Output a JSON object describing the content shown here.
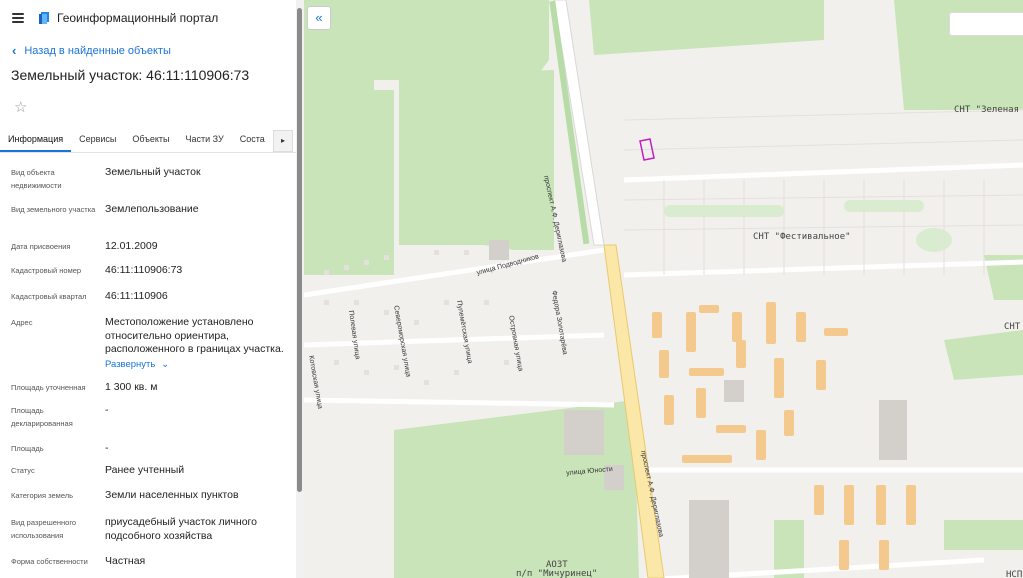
{
  "header": {
    "app_title": "Геоинформационный портал"
  },
  "nav": {
    "back_label": "Назад в найденные объекты"
  },
  "object": {
    "title": "Земельный участок: 46:11:110906:73"
  },
  "tabs": [
    "Информация",
    "Сервисы",
    "Объекты",
    "Части ЗУ",
    "Соста"
  ],
  "fields": [
    {
      "label": "Вид объекта недвижимости",
      "value": "Земельный участок"
    },
    {
      "label": "Вид земельного участка",
      "value": "Землепользование"
    },
    {
      "label": "Дата присвоения",
      "value": "12.01.2009"
    },
    {
      "label": "Кадастровый номер",
      "value": "46:11:110906:73"
    },
    {
      "label": "Кадастровый квартал",
      "value": "46:11:110906"
    },
    {
      "label": "Адрес",
      "value": "Местоположение установлено относительно ориентира, расположенного в границах участка."
    },
    {
      "label": "Площадь уточненная",
      "value": "1 300 кв. м"
    },
    {
      "label": "Площадь декларированная",
      "value": "-"
    },
    {
      "label": "Площадь",
      "value": "-"
    },
    {
      "label": "Статус",
      "value": "Ранее учтенный"
    },
    {
      "label": "Категория земель",
      "value": "Земли населенных пунктов"
    },
    {
      "label": "Вид разрешенного использования",
      "value": "приусадебный участок личного подсобного хозяйства"
    },
    {
      "label": "Форма собственности",
      "value": "Частная"
    }
  ],
  "expand_label": "Развернуть",
  "map": {
    "labels": {
      "snt_zelenaya": "СНТ \"Зеленая Роща\"",
      "snt_festivalnoe": "СНТ \"Фестивальное\"",
      "snt_right": "СНТ",
      "snt_br": "НСП",
      "azs": "АОЗТ",
      "stop": "п/п \"Мичуринец\""
    },
    "streets": {
      "prospekt_top": "проспект А.Ф. Дериглазова",
      "prospekt_bottom": "проспект А.Ф. Дериглазова",
      "podvodnikov": "улица Подводников",
      "yunosti": "улица Юности",
      "polevaya": "Полевая улица",
      "severomorskaya": "Североморская улица",
      "pulemetnaya": "Пулемётская улица",
      "ostrovnaya": "Островная улица",
      "zolotarev": "Федора Золотарёва",
      "kotovskaya": "Котовская улица"
    }
  },
  "colors": {
    "accent": "#1a73d9",
    "parcel": "#c020c0",
    "green": "#c8e3b9",
    "road": "#fbe8a8"
  }
}
